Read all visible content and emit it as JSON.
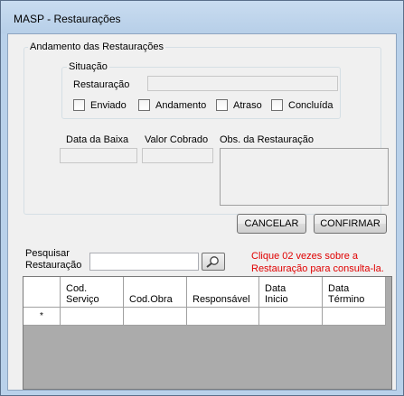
{
  "window": {
    "title": "MASP - Restaurações"
  },
  "group_andamento": {
    "legend": "Andamento das Restaurações"
  },
  "group_situacao": {
    "legend": "Situação"
  },
  "restauracao": {
    "label": "Restauração",
    "value": ""
  },
  "status_checkboxes": [
    {
      "label": "Enviado",
      "checked": false
    },
    {
      "label": "Andamento",
      "checked": false
    },
    {
      "label": "Atraso",
      "checked": false
    },
    {
      "label": "Concluída",
      "checked": false
    }
  ],
  "data_baixa": {
    "label": "Data da Baixa",
    "value": ""
  },
  "valor_cobrado": {
    "label": "Valor Cobrado",
    "value": ""
  },
  "obs": {
    "label": "Obs. da Restauração",
    "value": ""
  },
  "buttons": {
    "cancelar": "CANCELAR",
    "confirmar": "CONFIRMAR"
  },
  "search": {
    "label_line1": "Pesquisar",
    "label_line2": "Restauração",
    "value": "",
    "hint_line1": "Clique 02 vezes sobre a",
    "hint_line2": "Restauração para consulta-la.",
    "button_icon": "magnifier-icon"
  },
  "grid": {
    "columns": [
      {
        "line1": "Cod.",
        "line2": "Serviço"
      },
      {
        "line1": "",
        "line2": "Cod.Obra"
      },
      {
        "line1": "",
        "line2": "Responsável"
      },
      {
        "line1": "Data",
        "line2": "Inicio"
      },
      {
        "line1": "Data",
        "line2": "Término"
      }
    ],
    "new_row_marker": "*"
  },
  "colors": {
    "hint": "#e00000",
    "titlebar": "#b9d1ea",
    "client": "#f0f0f0"
  }
}
